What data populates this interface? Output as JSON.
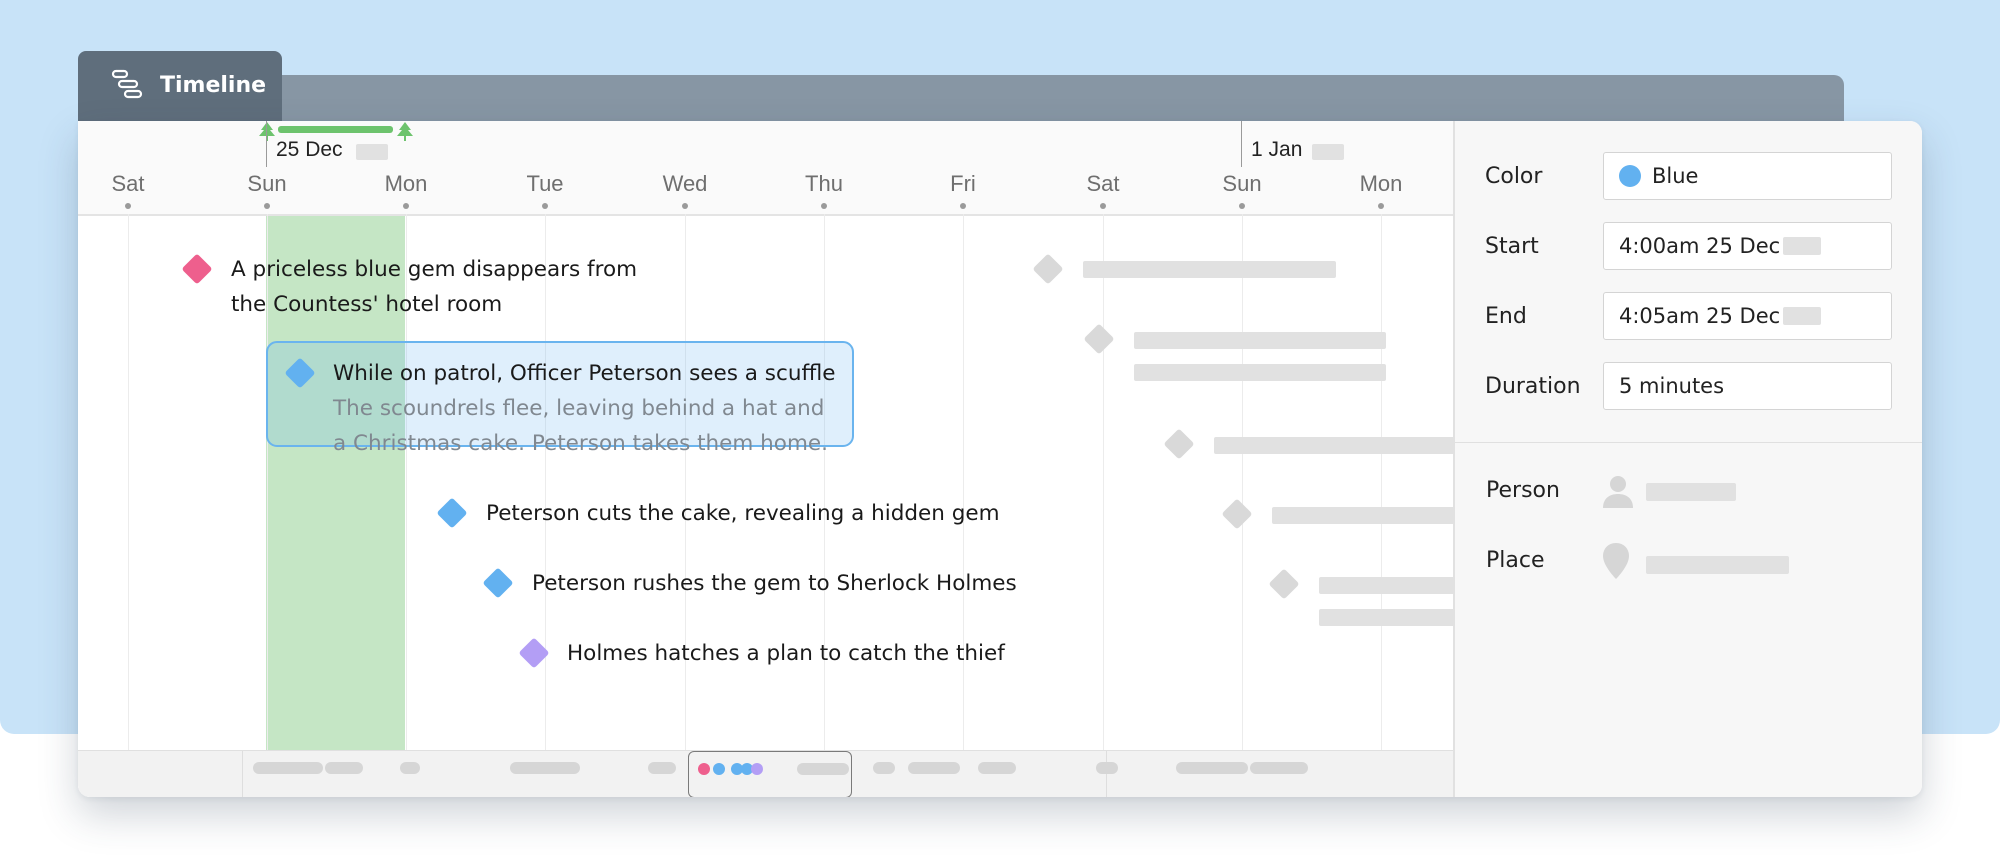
{
  "tab": {
    "title": "Timeline",
    "icon": "timeline-icon"
  },
  "header": {
    "days": [
      "Sat",
      "Sun",
      "Mon",
      "Tue",
      "Wed",
      "Thu",
      "Fri",
      "Sat",
      "Sun",
      "Mon"
    ],
    "dates": [
      {
        "label": "25 Dec",
        "icon": "christmas-tree-icon"
      },
      {
        "label": "1 Jan"
      }
    ]
  },
  "events": [
    {
      "title": "A priceless blue gem disappears from",
      "title_line2": "the Countess' hotel room",
      "color": "#ee5f8d"
    },
    {
      "title": "While on patrol, Officer Peterson sees a scuffle",
      "description_line1": "The scoundrels flee, leaving behind a hat and",
      "description_line2": "a Christmas cake. Peterson takes them home.",
      "color": "#62b1f0",
      "selected": true
    },
    {
      "title": "Peterson cuts the cake, revealing a hidden gem",
      "color": "#62b1f0"
    },
    {
      "title": "Peterson rushes the gem to Sherlock Holmes",
      "color": "#62b1f0"
    },
    {
      "title": "Holmes hatches a plan to catch the thief",
      "color": "#b39ef5"
    }
  ],
  "minimap": {
    "dot_colors": [
      "#ee5f8d",
      "#62b1f0",
      "#62b1f0",
      "#62b1f0",
      "#b39ef5"
    ]
  },
  "properties": {
    "color": {
      "label": "Color",
      "value": "Blue",
      "swatch": "#62b1f0"
    },
    "start": {
      "label": "Start",
      "value": "4:00am 25 Dec"
    },
    "end": {
      "label": "End",
      "value": "4:05am 25 Dec"
    },
    "duration": {
      "label": "Duration",
      "value": "5 minutes"
    },
    "person": {
      "label": "Person",
      "icon": "person-icon"
    },
    "place": {
      "label": "Place",
      "icon": "location-pin-icon"
    }
  },
  "colors": {
    "accent_blue": "#62b1f0",
    "pink": "#ee5f8d",
    "purple": "#b39ef5",
    "christmas_green": "#6dc36d",
    "tab_dark": "#5f6e7c",
    "background": "#c8e3f8"
  }
}
